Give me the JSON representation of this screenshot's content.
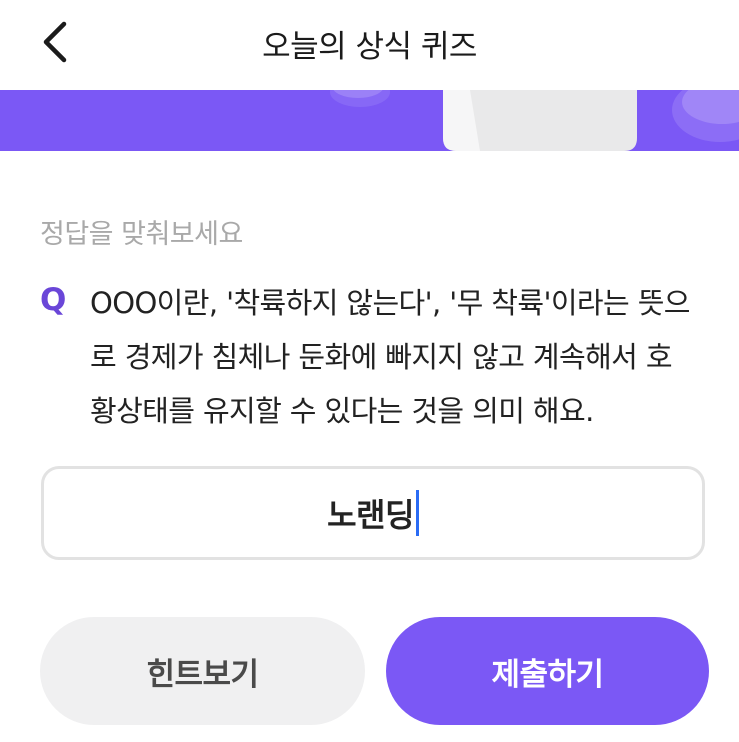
{
  "header": {
    "title": "오늘의 상식 퀴즈",
    "back_icon": "chevron-left-icon"
  },
  "banner": {
    "background_color": "#7b58f5"
  },
  "quiz": {
    "prompt": "정답을 맞춰보세요",
    "q_mark": "Q",
    "question_lines": [
      "OOO이란, '착륙하지 않는다', '무 착륙'이라는 뜻으",
      "로 경제가 침체나 둔화에 빠지지 않고 계속해서 호",
      "황상태를 유지할 수 있다는 것을 의미 해요."
    ]
  },
  "answer": {
    "value": "노랜딩"
  },
  "buttons": {
    "hint_label": "힌트보기",
    "submit_label": "제출하기"
  },
  "colors": {
    "accent": "#7b58f5",
    "q_mark": "#6a46d8",
    "caret": "#2a6cf5"
  }
}
